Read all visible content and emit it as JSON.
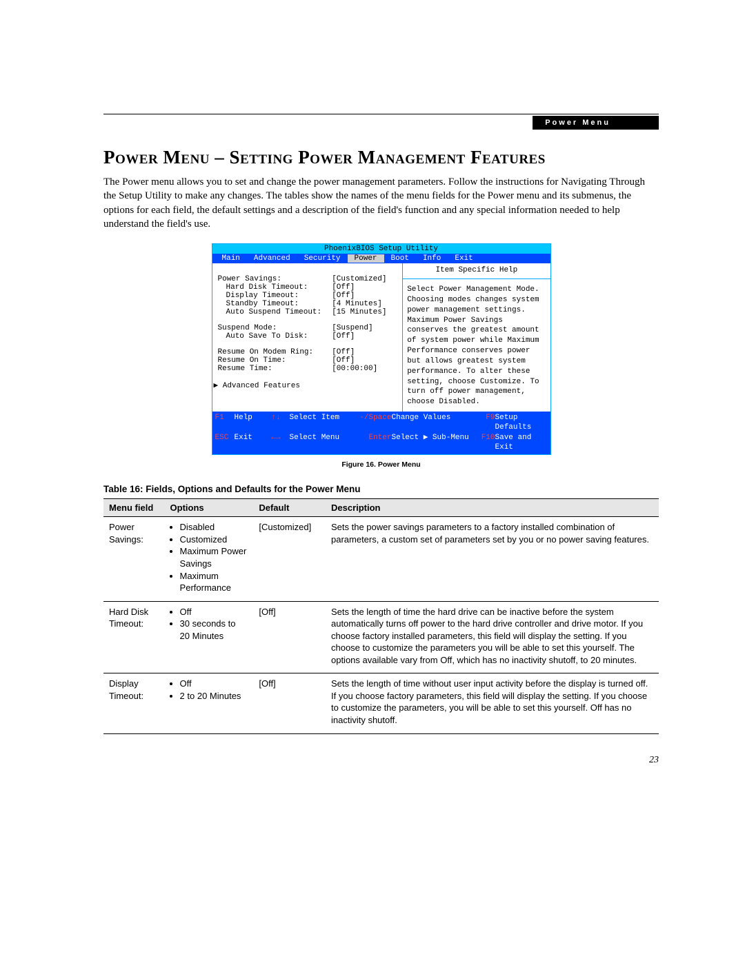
{
  "header_tab": "Power Menu",
  "section_title": "Power Menu – Setting Power Management Features",
  "intro": "The Power menu allows you to set and change the power management parameters. Follow the instructions for Navigating Through the Setup Utility to make any changes. The tables show the names of the menu fields for the Power menu and its submenus, the options for each field, the default settings and a description of the field's function and any special information needed to help understand the field's use.",
  "bios": {
    "title": "PhoenixBIOS Setup Utility",
    "menu": [
      "Main",
      "Advanced",
      "Security",
      "Power",
      "Boot",
      "Info",
      "Exit"
    ],
    "selected_menu_index": 3,
    "rows": [
      {
        "label": "Power Savings:",
        "value": "[Customized]",
        "highlight": true,
        "indent": false,
        "blankBefore": true
      },
      {
        "label": "Hard Disk Timeout:",
        "value": "[Off]",
        "indent": true
      },
      {
        "label": "Display Timeout:",
        "value": "[Off]",
        "indent": true
      },
      {
        "label": "Standby Timeout:",
        "value": "[4 Minutes]",
        "indent": true
      },
      {
        "label": "Auto Suspend Timeout:",
        "value": "[15 Minutes]",
        "indent": true
      },
      {
        "label": "Suspend Mode:",
        "value": "[Suspend]",
        "blankBefore": true
      },
      {
        "label": "Auto Save To Disk:",
        "value": "[Off]",
        "indent": true
      },
      {
        "label": "Resume On Modem Ring:",
        "value": "[Off]",
        "blankBefore": true
      },
      {
        "label": "Resume On Time:",
        "value": "[Off]"
      },
      {
        "label": "Resume Time:",
        "value": "[00:00:00]"
      },
      {
        "label": "▶ Advanced Features",
        "value": "",
        "blankBefore": true,
        "noval": true,
        "outdent": true
      }
    ],
    "help_title": "Item Specific Help",
    "help_body": "Select Power Management Mode. Choosing modes changes system power management settings. Maximum Power Savings conserves the greatest amount of system power while Maximum Performance conserves power but allows greatest system performance. To alter these setting, choose Customize. To turn off power management, choose Disabled.",
    "footer": {
      "r1": {
        "k1": "F1",
        "t1": "Help",
        "k2": "↑↓",
        "t2": "Select Item",
        "k3": "-/Space",
        "t3": "Change Values",
        "k4": "F9",
        "t4": "Setup Defaults"
      },
      "r2": {
        "k1": "ESC",
        "t1": "Exit",
        "k2": "←→",
        "t2": "Select Menu",
        "k3": "Enter",
        "t3": "Select ▶ Sub-Menu",
        "k4": "F10",
        "t4": "Save and Exit"
      }
    }
  },
  "figure_caption": "Figure 16.  Power Menu",
  "table_title": "Table 16: Fields, Options and Defaults for the Power Menu",
  "table_headers": [
    "Menu field",
    "Options",
    "Default",
    "Description"
  ],
  "table_rows": [
    {
      "menu": "Power Savings:",
      "options": [
        "Disabled",
        "Customized",
        "Maximum Power Savings",
        "Maximum Performance"
      ],
      "default": "[Customized]",
      "desc": "Sets the power savings parameters to a factory installed combination of parameters, a custom set of parameters set by you or no power saving features."
    },
    {
      "menu": "Hard Disk Timeout:",
      "options": [
        "Off",
        "30 seconds to 20 Minutes"
      ],
      "default": "[Off]",
      "desc": "Sets the length of time the hard drive can be inactive before the system automatically turns off power to the hard drive controller and drive motor. If you choose factory installed parameters, this field will display the setting. If you choose to customize the parameters you will be able to set this yourself. The options available vary from Off, which has no inactivity shutoff, to 20 minutes."
    },
    {
      "menu": "Display Timeout:",
      "options": [
        "Off",
        "2 to 20 Minutes"
      ],
      "default": "[Off]",
      "desc": "Sets the length of time without user input activity before the display is turned off. If you choose factory parameters, this field will display the setting. If you choose to customize the parameters, you will be able to set this yourself. Off has no inactivity shutoff."
    }
  ],
  "page_number": "23"
}
